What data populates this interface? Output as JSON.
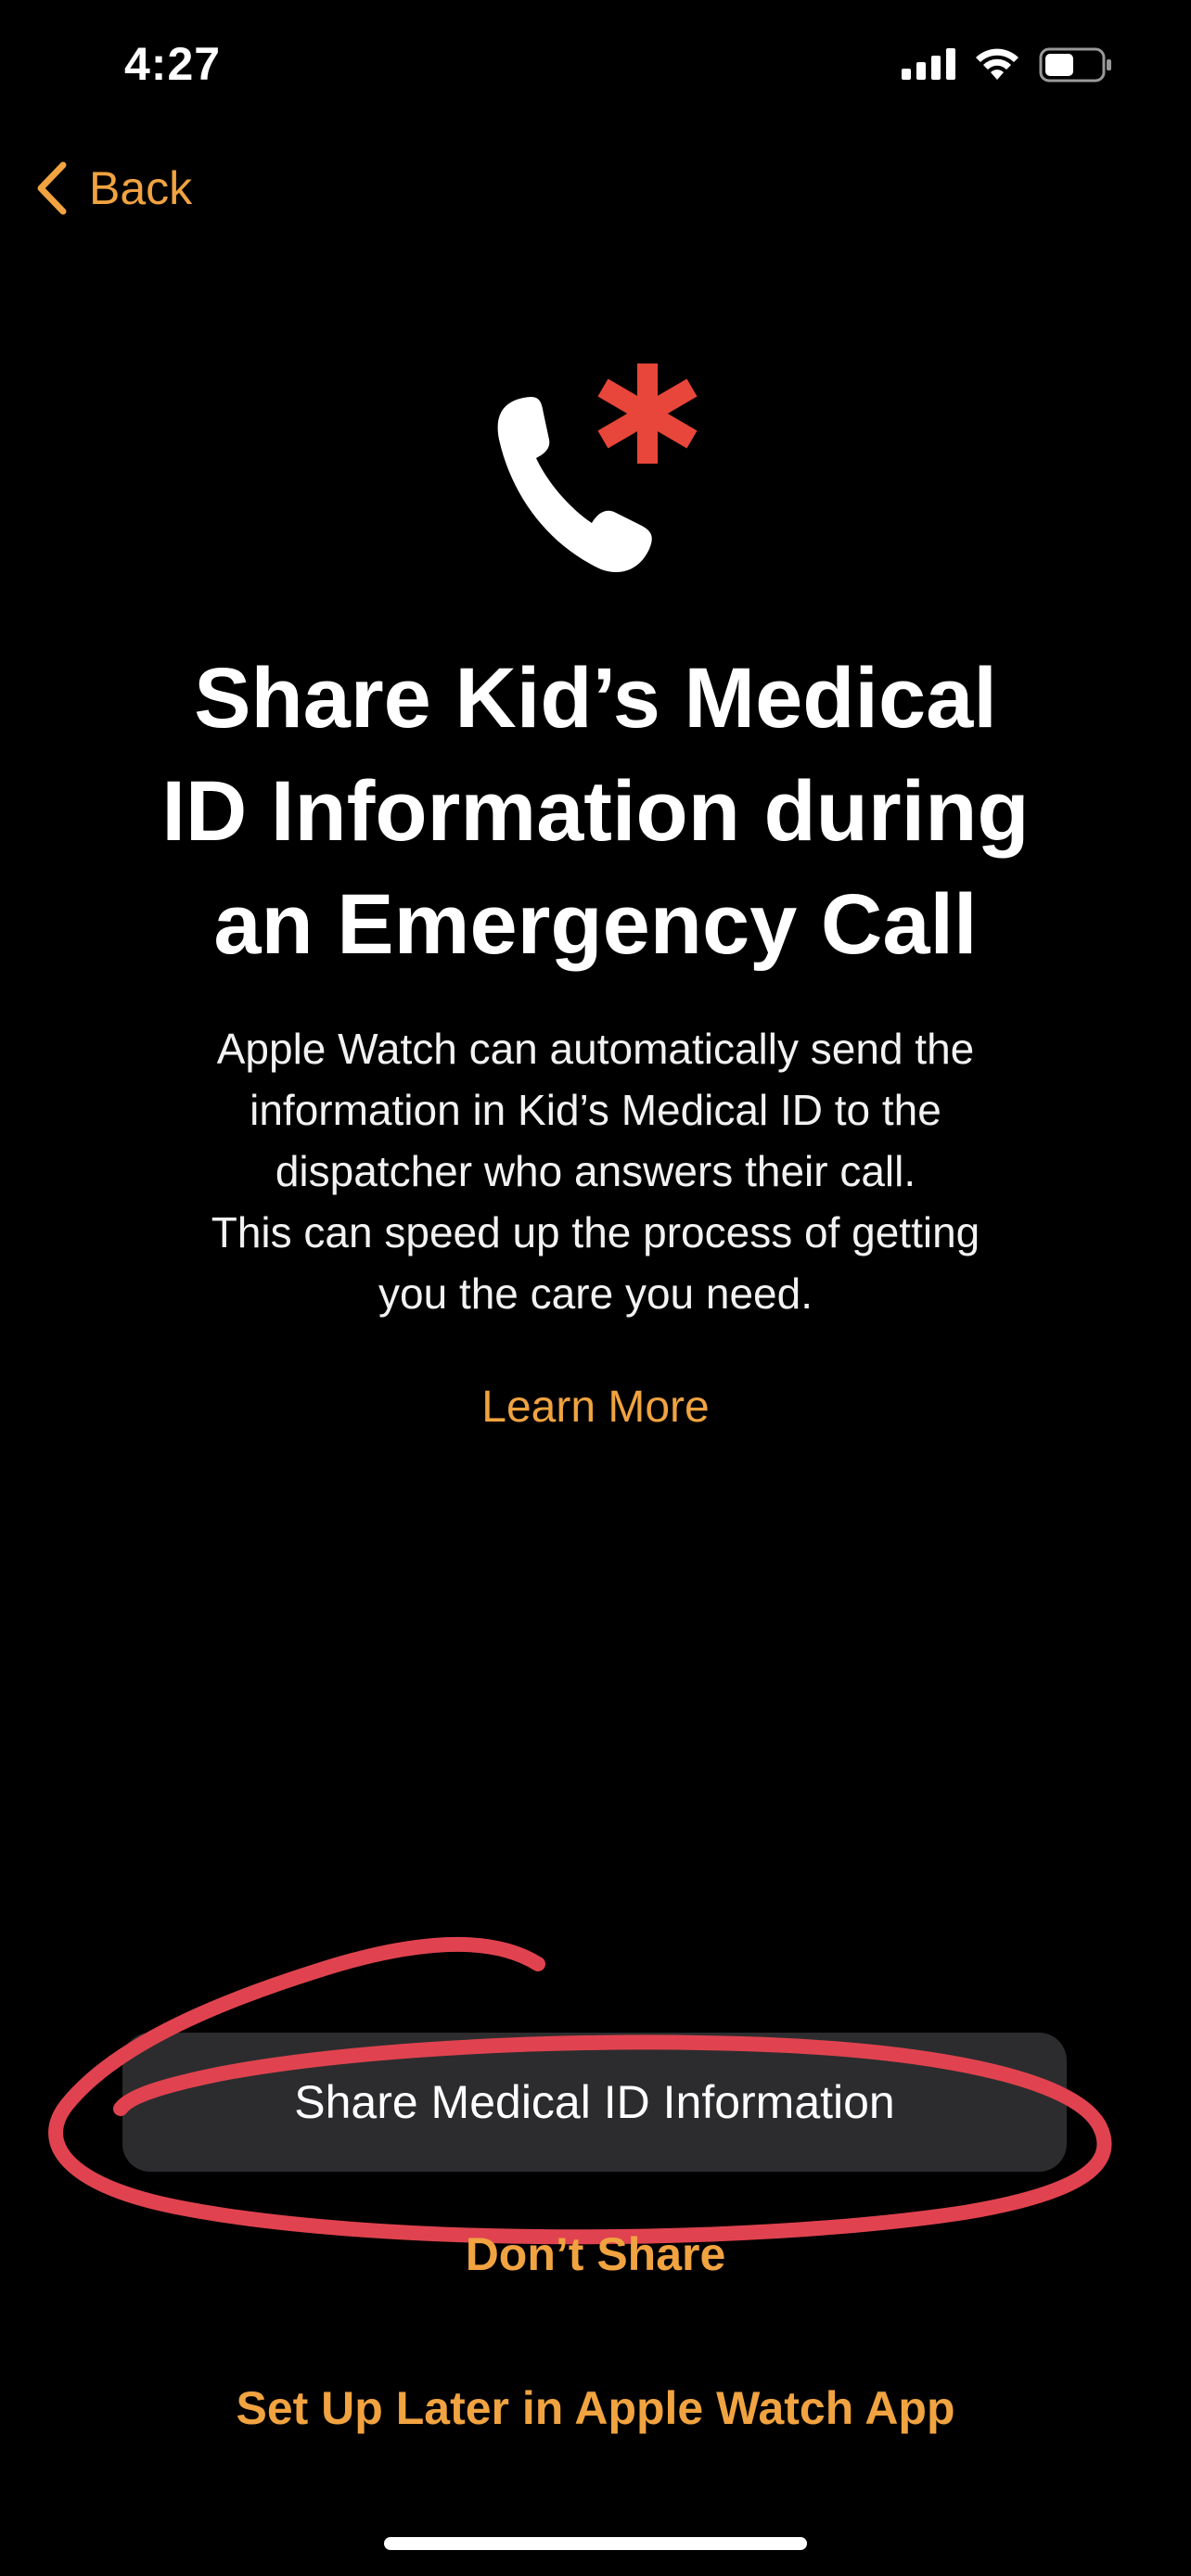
{
  "status_bar": {
    "time": "4:27"
  },
  "nav": {
    "back_label": "Back"
  },
  "content": {
    "title_lines": [
      "Share Kid’s Medical",
      "ID Information during",
      "an Emergency Call"
    ],
    "description_lines": [
      "Apple Watch can automatically send the",
      "information in Kid’s Medical ID to the",
      "dispatcher who answers their call.",
      "This can speed up the process of getting",
      "you the care you need."
    ],
    "learn_more": "Learn More"
  },
  "actions": {
    "primary": "Share Medical ID Information",
    "secondary": "Don’t Share",
    "tertiary": "Set Up Later in Apple Watch App"
  },
  "colors": {
    "accent": "#F0A340",
    "emergency_red": "#E8463A",
    "annotation_red": "#E0434F",
    "button_bg": "#2C2C2E"
  },
  "icons": {
    "hero": "phone-with-asterisk-icon",
    "back": "chevron-left-icon"
  }
}
